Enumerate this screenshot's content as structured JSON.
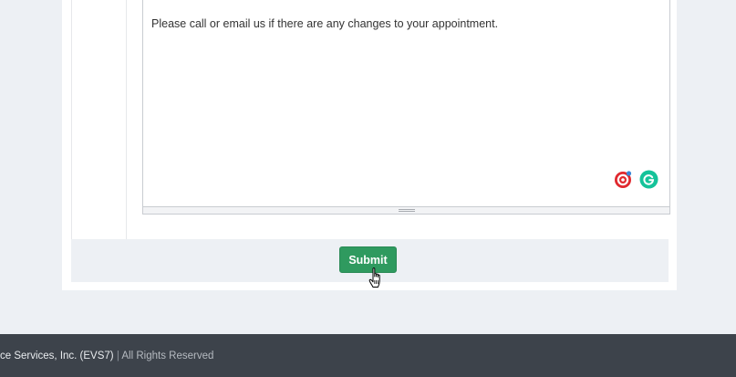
{
  "editor": {
    "text": "Please call or email us if there are any changes to your appointment."
  },
  "form": {
    "submit_label": "Submit"
  },
  "icons": {
    "target": "target-extension-icon",
    "grammarly": "grammarly-icon",
    "cursor": "hand-pointer-cursor"
  },
  "footer": {
    "company": "ce Services, Inc. (EVS7)",
    "separator": "|",
    "rights": "All Rights Reserved"
  },
  "colors": {
    "page_bg": "#edf0f4",
    "submit_green": "#2f9a5f",
    "footer_bg": "#3d434b",
    "grammarly_green": "#15c39a",
    "target_red": "#e0282e"
  }
}
